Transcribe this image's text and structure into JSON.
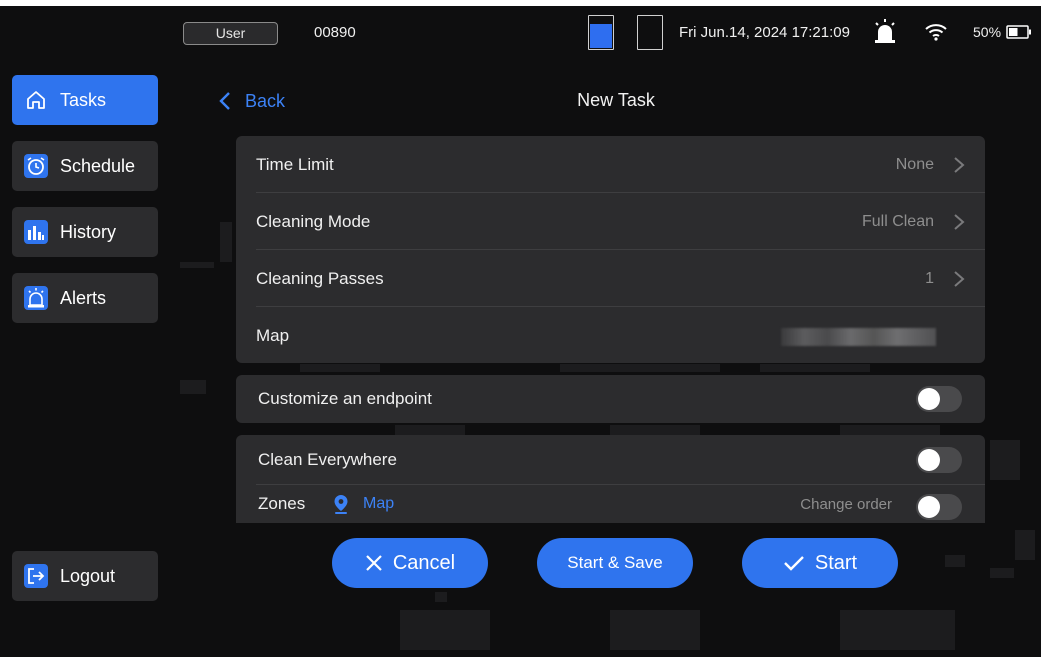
{
  "status_bar": {
    "user_label": "User",
    "user_id": "00890",
    "datetime": "Fri Jun.14, 2024 17:21:09",
    "battery_percent": "50%",
    "battery_level": 0.5,
    "icons": [
      "tank-full-icon",
      "tank-empty-icon",
      "alarm-icon",
      "wifi-icon",
      "battery-icon"
    ]
  },
  "sidebar": {
    "items": [
      {
        "label": "Tasks",
        "icon": "home-icon",
        "active": true
      },
      {
        "label": "Schedule",
        "icon": "clock-icon",
        "active": false
      },
      {
        "label": "History",
        "icon": "bar-chart-icon",
        "active": false
      },
      {
        "label": "Alerts",
        "icon": "alarm-icon",
        "active": false
      }
    ],
    "logout_label": "Logout"
  },
  "header": {
    "back_label": "Back",
    "title": "New Task"
  },
  "settings": {
    "time_limit": {
      "label": "Time Limit",
      "value": "None"
    },
    "cleaning_mode": {
      "label": "Cleaning Mode",
      "value": "Full Clean"
    },
    "cleaning_passes": {
      "label": "Cleaning Passes",
      "value": "1"
    },
    "map": {
      "label": "Map"
    }
  },
  "endpoint": {
    "label": "Customize an endpoint",
    "enabled": false
  },
  "zones_panel": {
    "clean_everywhere": {
      "label": "Clean Everywhere",
      "enabled": false
    },
    "zones": {
      "label": "Zones",
      "map_link": "Map",
      "change_order_label": "Change order",
      "change_order_enabled": false
    }
  },
  "actions": {
    "cancel": "Cancel",
    "start_save": "Start & Save",
    "start": "Start"
  },
  "colors": {
    "accent": "#2f74ee",
    "link": "#3c82f6",
    "panel": "#2c2c2e",
    "background": "#0e0e0f"
  }
}
